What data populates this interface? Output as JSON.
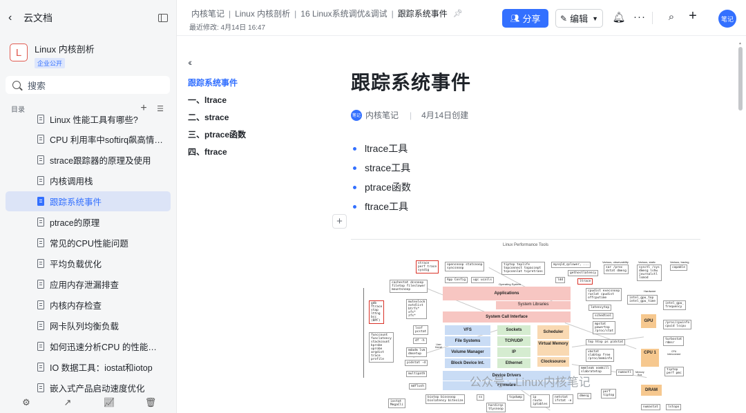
{
  "sidebar": {
    "back_label": "云文档",
    "kb_logo_letter": "L",
    "kb_name": "Linux 内核剖析",
    "kb_badge": "企业公开",
    "search_placeholder": "搜索",
    "toc_label": "目录",
    "items": [
      {
        "label": "Linux 性能工具有哪些?",
        "active": false
      },
      {
        "label": "CPU 利用率中softirq飙高情况...",
        "active": false
      },
      {
        "label": "strace跟踪器的原理及使用",
        "active": false
      },
      {
        "label": "内核调用栈",
        "active": false
      },
      {
        "label": "跟踪系统事件",
        "active": true
      },
      {
        "label": "ptrace的原理",
        "active": false
      },
      {
        "label": "常见的CPU性能问题",
        "active": false
      },
      {
        "label": "平均负载优化",
        "active": false
      },
      {
        "label": "应用内存泄漏排查",
        "active": false
      },
      {
        "label": "内核内存检查",
        "active": false
      },
      {
        "label": "网卡队列均衡负载",
        "active": false
      },
      {
        "label": "如何迅速分析CPU 的性能瓶颈",
        "active": false
      },
      {
        "label": "IO 数据工具：iostat和iotop",
        "active": false
      },
      {
        "label": "嵌入式产品启动速度优化",
        "active": false
      }
    ]
  },
  "topbar": {
    "breadcrumbs": [
      "内核笔记",
      "Linux 内核剖析",
      "16 Linux系统调优&调试",
      "跟踪系统事件"
    ],
    "last_modified": "最近修改: 4月14日 16:47",
    "share_label": "分享",
    "edit_label": "编辑",
    "avatar_text": "笔记"
  },
  "outline": {
    "items": [
      {
        "label": "跟踪系统事件",
        "active": true
      },
      {
        "label": "一、ltrace",
        "active": false
      },
      {
        "label": "二、strace",
        "active": false
      },
      {
        "label": "三、ptrace函数",
        "active": false
      },
      {
        "label": "四、ftrace",
        "active": false
      }
    ]
  },
  "document": {
    "title": "跟踪系统事件",
    "author_avatar": "笔记",
    "author": "内核笔记",
    "created": "4月14日创建",
    "bullets": [
      "ltrace工具",
      "strace工具",
      "ptrace函数",
      "ftrace工具"
    ]
  },
  "diagram": {
    "title": "Linux Performance Tools",
    "layers": {
      "applications": "Applications",
      "system_libraries": "System Libraries",
      "syscall_interface": "System Call Interface",
      "vfs": "VFS",
      "sockets": "Sockets",
      "scheduler": "Scheduler",
      "file_systems": "File Systems",
      "tcp_udp": "TCP/UDP",
      "virtual_memory": "Virtual Memory",
      "volume_manager": "Volume Manager",
      "ip": "IP",
      "block_device": "Block Device Int.",
      "ethernet": "Ethernet",
      "clocksource": "Clocksource",
      "device_drivers": "Device Drivers",
      "firmware": "Firmware",
      "gpu": "GPU",
      "cpu": "CPU 1",
      "dram": "DRAM"
    },
    "tools": {
      "strace": "strace\nperf trace\nsysdig",
      "opensnoop": "opensnoop statsnoop\nsyncsnoop",
      "tiptop": "tiptop toplife\ntopconnect topaccept\ntcpconnlat tcpretrans",
      "mysqld": "mysqld_qslower, ...",
      "vmstat_top": "sar /proc\ndstat dmesg",
      "sysctl": "sysctl /sys\ndmesg lshw\njournalctl\nlsmod",
      "capable": "capable",
      "ltrace_box": "ltrace",
      "gethostlatency": "gethostlatency",
      "ldd": "ldd",
      "app_config": "App Config",
      "ugc": "ugc ucalls",
      "cachestat": "cachestat dcsnoop\nfiletop fileslower\nmountsnoop",
      "mutex": "mutexlock\nextdlist\nbtrfs*\nxfs*\nzfs*",
      "gdb_left": "gdb\nftrace\nstap\nlttng\nbcc\n(BPF)",
      "funccount": "funccount\nfunclatency\nstackcount\nkprobe\nuprobe\nargdist\ntrace\nprofile",
      "lsof": "lsof\npcstat",
      "df": "df -h",
      "mdadm": "mdadm lvm\ndmsetup",
      "pidstat": "pidstat -d",
      "multipath": "multipath",
      "mdflush": "mdflush",
      "cpudist": "cpudist execsnoop\nrunlat cpudist\noffcputime",
      "latencytop": "latencytop",
      "schedtool": "schedtool",
      "mpstat": "mpstat\npowertop\n/proc/stat",
      "top_htop": "top htop ps pidstat",
      "vmstat": "vmstat\nslabtop free\n/proc/meminfo",
      "memleak": "memleak oomkill\nslabratetop",
      "numactl": "numactl",
      "perf": "perf\ntiptop",
      "intel_gpu": "intel_gpu_top\nintel_gpu_time",
      "intel_gpu_freq": "intel_gpu_\nfrequency",
      "proc_cpuinfo": "/proc/cpuinfo\ncpuid lscpu",
      "turbostat": "turbostat\nrdmsr",
      "tiptop2": "tiptop\nperf pmc",
      "biotop": "biotop biosnoop\nbiolatency bitesize",
      "ss": "ss",
      "tcpdump": "tcpdump",
      "ip_route": "ip\nroute\niptables",
      "netstat": "netstat\nifstat -e",
      "dmesg": "dmesg",
      "iostat": "iostat\nMegaCli",
      "hardirqs": "hardirqs\nttysnoop",
      "numastat": "numastat",
      "lstopo": "lstopo"
    },
    "labels": {
      "os_label": "Operating System",
      "hardware": "Hardware",
      "various_obs": "Various, observability",
      "various_static": "Various, static",
      "various_tracing": "Various, tracing",
      "user_kernel": "User\nKernel",
      "cpu_interconnect": "CPU\nInterconnect",
      "memory_bus": "Memory\nBus"
    }
  },
  "watermark": "公众号 · Linux内核笔记"
}
